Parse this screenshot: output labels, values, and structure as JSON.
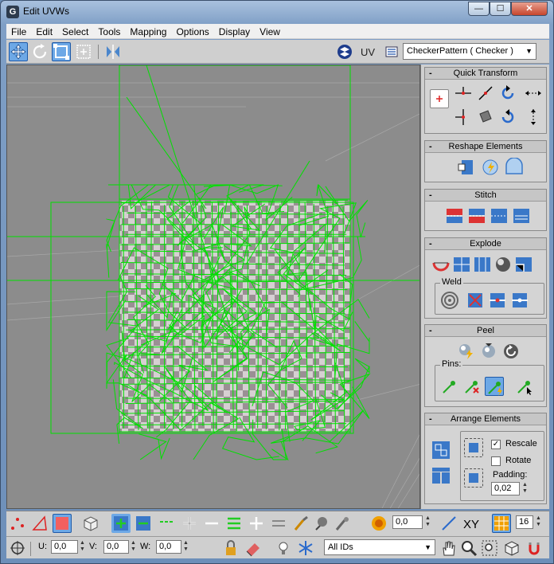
{
  "window": {
    "title": "Edit UVWs",
    "app_icon": "G",
    "min_glyph": "—",
    "max_glyph": "☐",
    "close_glyph": "✕"
  },
  "menu": [
    "File",
    "Edit",
    "Select",
    "Tools",
    "Mapping",
    "Options",
    "Display",
    "View"
  ],
  "toolbar": {
    "uv_label": "UV",
    "texture_combo": "CheckerPattern  ( Checker )",
    "combo_arrow": "▼"
  },
  "panel": {
    "quick_transform": {
      "title": "Quick Transform"
    },
    "reshape_elements": {
      "title": "Reshape Elements"
    },
    "stitch": {
      "title": "Stitch"
    },
    "explode": {
      "title": "Explode",
      "weld_label": "Weld"
    },
    "peel": {
      "title": "Peel",
      "pins_label": "Pins:"
    },
    "arrange_elements": {
      "title": "Arrange Elements",
      "rescale_label": "Rescale",
      "rescale_checked": true,
      "rotate_label": "Rotate",
      "rotate_checked": false,
      "padding_label": "Padding:",
      "padding_value": "0,02"
    }
  },
  "bottom": {
    "value1": "0,0",
    "xy_label": "XY",
    "grid_value": "16",
    "u_label": "U:",
    "u_value": "0,0",
    "v_label": "V:",
    "v_value": "0,0",
    "w_label": "W:",
    "w_value": "0,0",
    "ids_combo": "All IDs"
  },
  "colors": {
    "selection_wire": "#00e000",
    "viewport_bg": "#8c8c8c",
    "accent": "#6da8e6",
    "checker_light": "#d6d0d2",
    "checker_dark": "#9a9094"
  }
}
